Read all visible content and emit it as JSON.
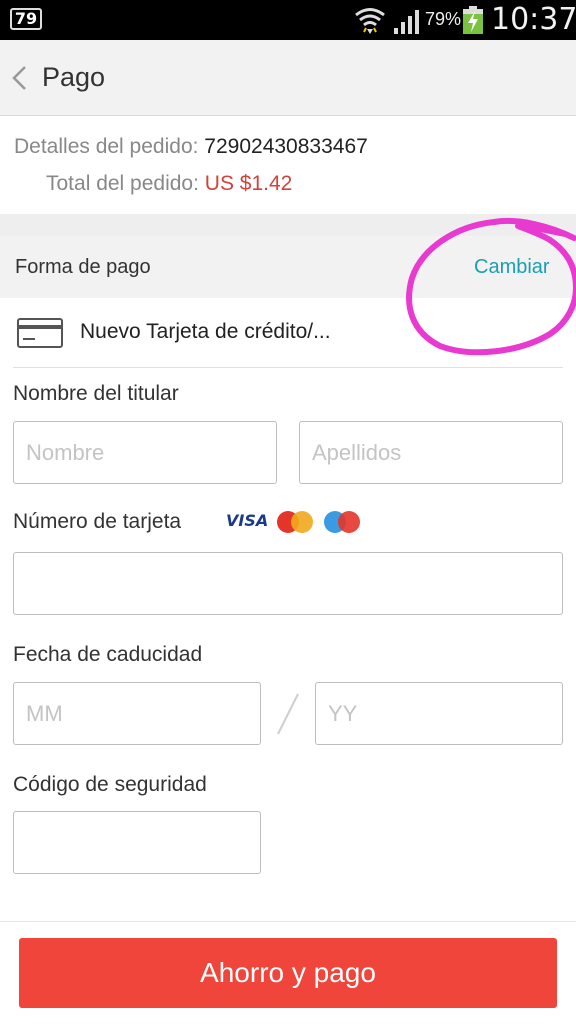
{
  "status_bar": {
    "notification_badge": "79",
    "battery_percent": "79%",
    "time": "10:37",
    "icons": [
      "wifi-icon",
      "signal-icon",
      "battery-charging-icon"
    ]
  },
  "header": {
    "title": "Pago",
    "back_icon": "chevron-left-icon"
  },
  "order": {
    "details_label": "Detalles del pedido: ",
    "order_number": "72902430833467",
    "total_label": "Total del pedido: ",
    "total_value": "US $1.42"
  },
  "payment_method": {
    "title": "Forma de pago",
    "change_label": "Cambiar",
    "selected": "Nuevo Tarjeta de crédito/...",
    "selected_icon": "credit-card-icon"
  },
  "form": {
    "holder_label": "Nombre del titular",
    "first_name_placeholder": "Nombre",
    "last_name_placeholder": "Apellidos",
    "card_number_label": "Número de tarjeta",
    "card_brands": {
      "visa": "VISA",
      "mastercard": "MasterCard",
      "maestro": "Maestro"
    },
    "expiry_label": "Fecha de caducidad",
    "month_placeholder": "MM",
    "year_placeholder": "YY",
    "cvv_label": "Código de seguridad"
  },
  "pay_button": "Ahorro y pago",
  "colors": {
    "accent_red": "#f0453a",
    "price_red": "#d0443a",
    "link_teal": "#1a9fb0",
    "annotation_pink": "#e83ad0"
  }
}
